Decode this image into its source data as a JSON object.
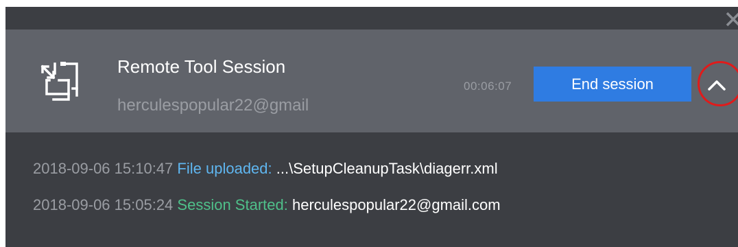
{
  "session": {
    "title": "Remote Tool Session",
    "user": "herculespopular22@gmail",
    "timer": "00:06:07",
    "end_button_label": "End session"
  },
  "log": [
    {
      "timestamp": "2018-09-06 15:10:47",
      "event": "File uploaded:",
      "detail": "...\\SetupCleanupTask\\diagerr.xml"
    },
    {
      "timestamp": "2018-09-06 15:05:24",
      "event": "Session Started:",
      "detail": "herculespopular22@gmail.com"
    }
  ],
  "icons": {
    "session": "remote-session-icon",
    "close": "close-icon",
    "collapse": "chevron-up-icon"
  },
  "colors": {
    "panel": "#60636a",
    "background": "#3c3e43",
    "accent": "#2f7ce2",
    "upload_event": "#5fb6f0",
    "start_event": "#4fc08a",
    "highlight": "#e01b1b"
  }
}
